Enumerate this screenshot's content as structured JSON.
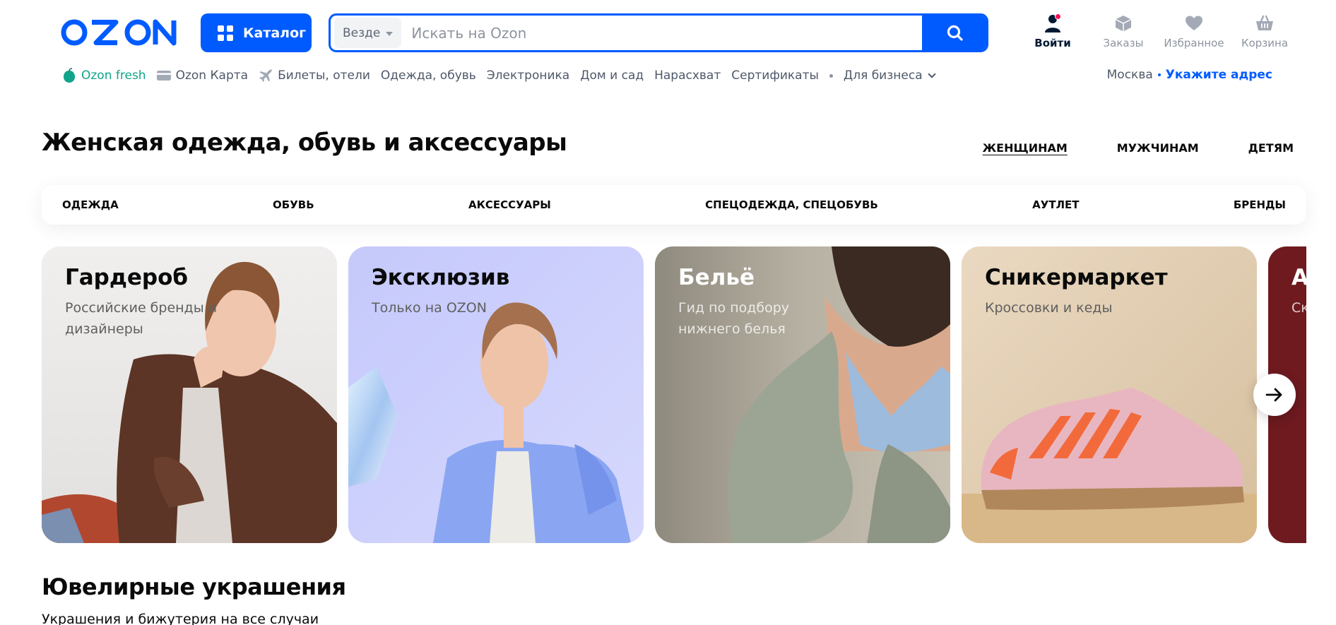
{
  "header": {
    "logo_text": "OZON",
    "catalog_label": "Каталог",
    "search": {
      "scope": "Везде",
      "placeholder": "Искать на Ozon"
    },
    "actions": [
      {
        "label": "Войти",
        "icon": "user-icon"
      },
      {
        "label": "Заказы",
        "icon": "box-icon"
      },
      {
        "label": "Избранное",
        "icon": "heart-icon"
      },
      {
        "label": "Корзина",
        "icon": "basket-icon"
      }
    ]
  },
  "subnav": {
    "items": [
      "Ozon fresh",
      "Ozon Карта",
      "Билеты, отели",
      "Одежда, обувь",
      "Электроника",
      "Дом и сад",
      "Нарасхват",
      "Сертификаты"
    ],
    "business": "Для бизнеса"
  },
  "location": {
    "city": "Москва",
    "address_link": "Укажите адрес"
  },
  "section": {
    "title": "Женская одежда, обувь и аксессуары",
    "audience": [
      "ЖЕНЩИНАМ",
      "МУЖЧИНАМ",
      "ДЕТЯМ"
    ],
    "categories": [
      "ОДЕЖДА",
      "ОБУВЬ",
      "АКСЕССУАРЫ",
      "СПЕЦОДЕЖДА, СПЕЦОБУВЬ",
      "АУТЛЕТ",
      "БРЕНДЫ"
    ]
  },
  "cards": [
    {
      "title": "Гардероб",
      "subtitle": "Российские бренды и дизайнеры"
    },
    {
      "title": "Эксклюзив",
      "subtitle": "Только на OZON"
    },
    {
      "title": "Бельё",
      "subtitle": "Гид по подбору нижнего белья"
    },
    {
      "title": "Сникермаркет",
      "subtitle": "Кроссовки и кеды"
    },
    {
      "title": "А",
      "subtitle": "Ск"
    }
  ],
  "jewelry": {
    "title": "Ювелирные украшения",
    "subtitle": "Украшения и бижутерия на все случаи"
  },
  "colors": {
    "brand": "#005bff",
    "fresh": "#10a58b",
    "badge": "#f91155"
  }
}
